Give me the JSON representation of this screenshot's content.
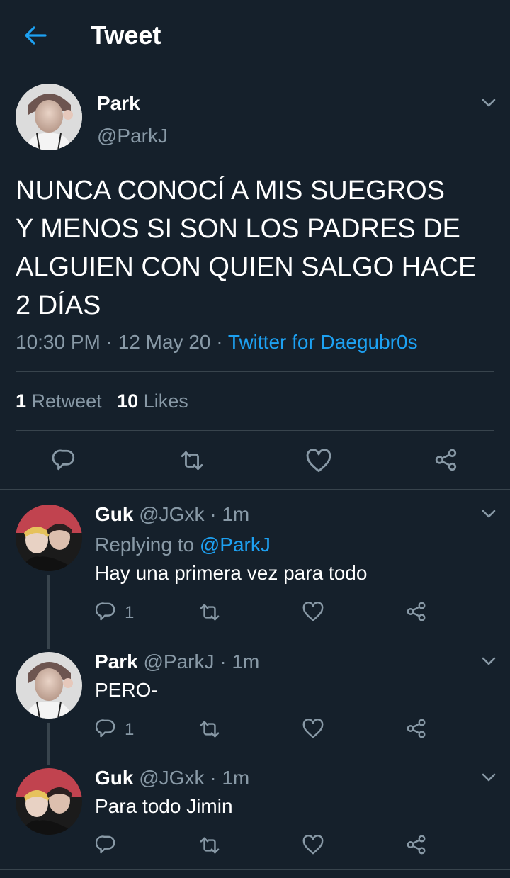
{
  "header": {
    "title": "Tweet"
  },
  "main_tweet": {
    "name": "Park",
    "handle": "@ParkJ",
    "text_lines": [
      "NUNCA CONOCÍ A MIS SUEGROS",
      "Y MENOS SI SON LOS PADRES DE",
      "ALGUIEN CON QUIEN SALGO HACE",
      "2 DÍAS"
    ],
    "time": "10:30 PM",
    "date": "12 May 20",
    "source": "Twitter for Daegubr0s",
    "retweet_count": "1",
    "retweet_label": "Retweet",
    "like_count": "10",
    "like_label": "Likes"
  },
  "replies": [
    {
      "name": "Guk",
      "handle": "@JGxk",
      "time": "1m",
      "replying_prefix": "Replying to",
      "replying_to": "@ParkJ",
      "text": "Hay una primera vez para todo",
      "reply_count": "1"
    },
    {
      "name": "Park",
      "handle": "@ParkJ",
      "time": "1m",
      "text": "PERO-",
      "reply_count": "1"
    },
    {
      "name": "Guk",
      "handle": "@JGxk",
      "time": "1m",
      "text": "Para todo Jimin",
      "reply_count": ""
    }
  ],
  "separator": "·",
  "colors": {
    "background": "#15202b",
    "accent": "#1da1f2",
    "muted": "#8899a6",
    "border": "#38444d"
  },
  "icons": [
    "back-arrow-icon",
    "chevron-down-icon",
    "reply-icon",
    "retweet-icon",
    "like-icon",
    "share-icon"
  ]
}
